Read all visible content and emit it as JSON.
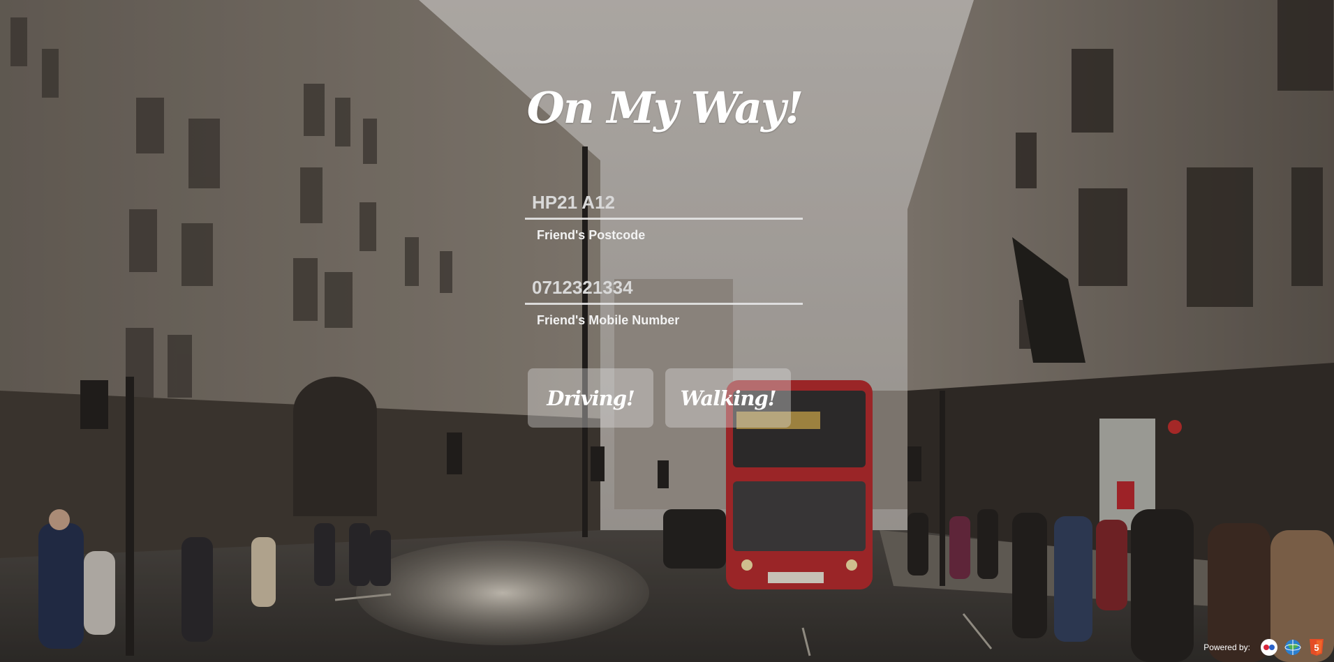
{
  "app": {
    "title": "On My Way!"
  },
  "form": {
    "postcode": {
      "value": "HP21 A12",
      "label": "Friend's Postcode"
    },
    "mobile": {
      "value": "0712321334",
      "label": "Friend's Mobile Number"
    }
  },
  "buttons": {
    "driving": "Driving!",
    "walking": "Walking!"
  },
  "footer": {
    "powered_by": "Powered by:",
    "icons": [
      "api-logo-icon",
      "globe-icon",
      "html5-icon"
    ]
  },
  "colors": {
    "bus_red": "#c2262b",
    "sky": "#b8b4b0",
    "button_bg": "rgba(225,225,225,0.38)",
    "html5_orange": "#e44d26"
  }
}
